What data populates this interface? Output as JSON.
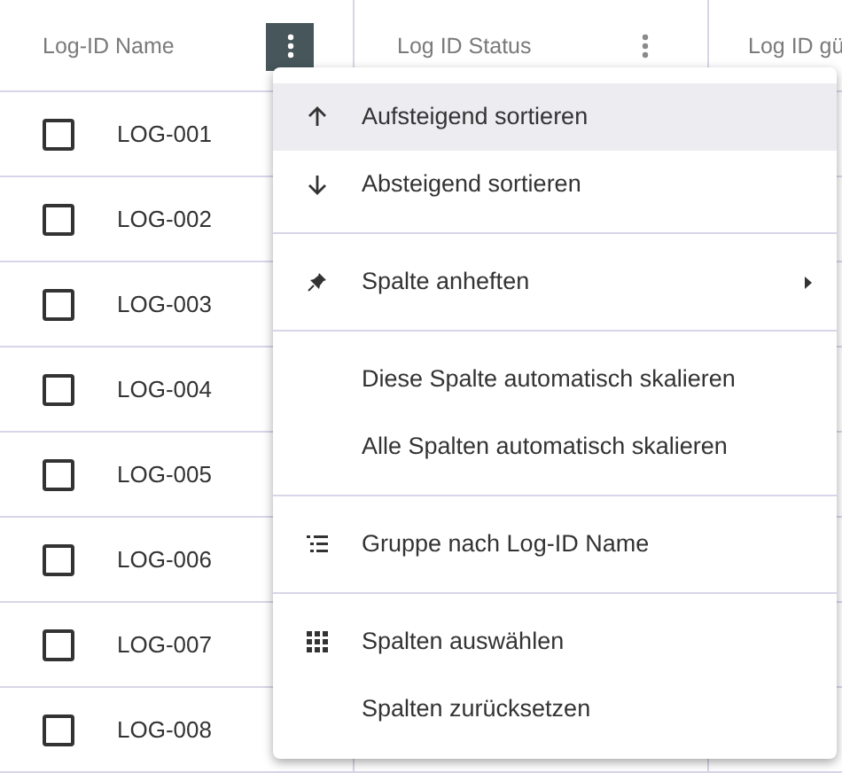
{
  "columns": [
    {
      "label": "Log-ID Name",
      "menu_open": true
    },
    {
      "label": "Log ID Status",
      "menu_open": false
    },
    {
      "label": "Log ID gü"
    }
  ],
  "rows": [
    {
      "checked": false,
      "name": "LOG-001"
    },
    {
      "checked": false,
      "name": "LOG-002"
    },
    {
      "checked": false,
      "name": "LOG-003"
    },
    {
      "checked": false,
      "name": "LOG-004"
    },
    {
      "checked": false,
      "name": "LOG-005"
    },
    {
      "checked": false,
      "name": "LOG-006"
    },
    {
      "checked": false,
      "name": "LOG-007"
    },
    {
      "checked": false,
      "name": "LOG-008"
    }
  ],
  "column_menu": {
    "sections": [
      [
        {
          "kind": "ascending",
          "label": "Aufsteigend sortieren",
          "selected": true,
          "submenu": false
        },
        {
          "kind": "descending",
          "label": "Absteigend sortieren",
          "selected": false,
          "submenu": false
        }
      ],
      [
        {
          "kind": "pin",
          "label": "Spalte anheften",
          "selected": false,
          "submenu": true
        }
      ],
      [
        {
          "kind": "plain",
          "label": "Diese Spalte automatisch skalieren",
          "selected": false,
          "submenu": false
        },
        {
          "kind": "plain",
          "label": "Alle Spalten automatisch skalieren",
          "selected": false,
          "submenu": false
        }
      ],
      [
        {
          "kind": "group",
          "label": "Gruppe nach Log-ID Name",
          "selected": false,
          "submenu": false
        }
      ],
      [
        {
          "kind": "grid",
          "label": "Spalten auswählen",
          "selected": false,
          "submenu": false
        },
        {
          "kind": "plain",
          "label": "Spalten zurücksetzen",
          "selected": false,
          "submenu": false
        }
      ]
    ]
  }
}
